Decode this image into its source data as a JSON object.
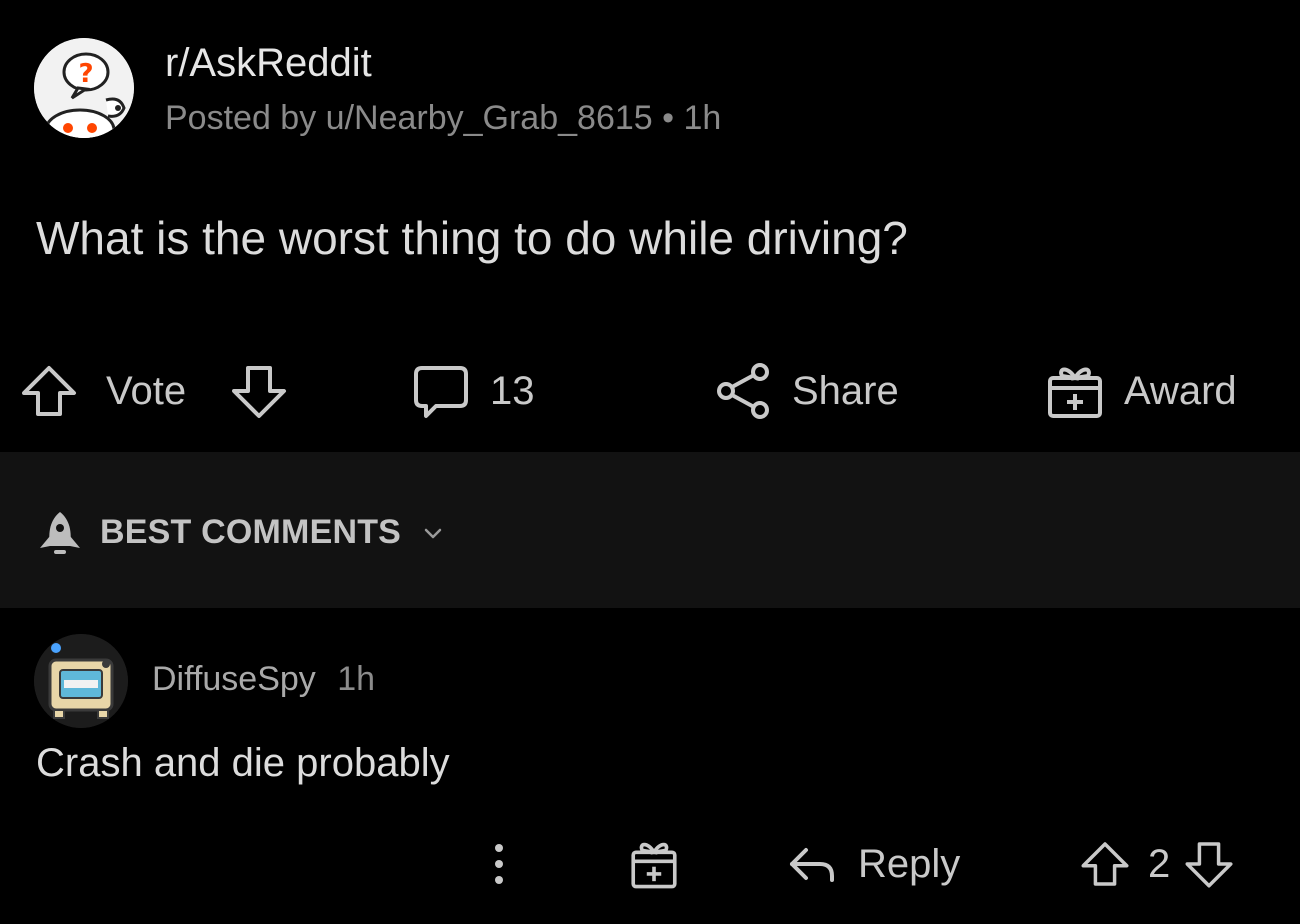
{
  "post": {
    "subreddit": "r/AskReddit",
    "meta_prefix": "Posted by",
    "author": "u/Nearby_Grab_8615",
    "separator": "•",
    "time": "1h",
    "title": "What is the worst thing to do while driving?",
    "actions": {
      "vote_label": "Vote",
      "comment_count": "13",
      "share_label": "Share",
      "award_label": "Award"
    },
    "sub_icon": "askreddit-snoo-icon"
  },
  "sort": {
    "label": "BEST COMMENTS",
    "icon": "rocket-icon"
  },
  "comment": {
    "author": "DiffuseSpy",
    "time": "1h",
    "body": "Crash and die probably",
    "score": "2",
    "reply_label": "Reply",
    "avatar_icon": "snoo-avatar-icon"
  },
  "colors": {
    "background": "#000000",
    "sort_bar": "#121212",
    "text_primary": "#dcdcdc",
    "text_muted": "#8a8a8a"
  }
}
